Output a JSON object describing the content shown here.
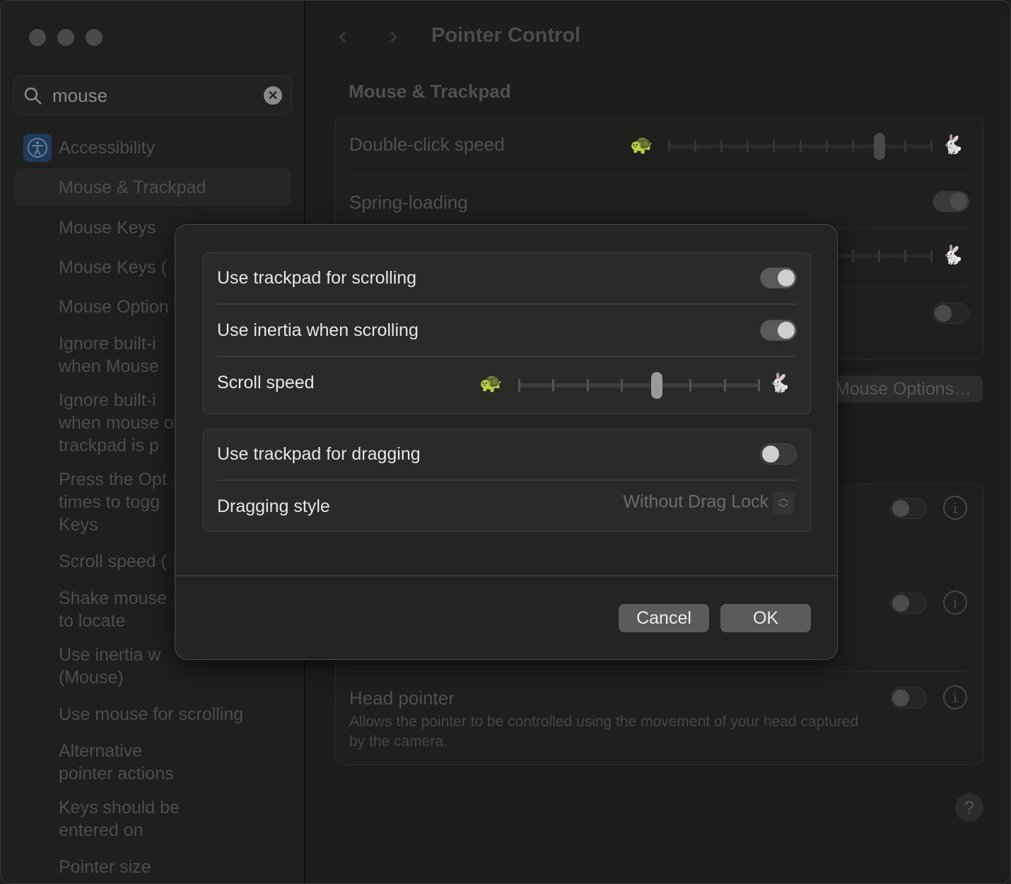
{
  "window": {
    "title": "Pointer Control",
    "traffic_lights": [
      "close",
      "minimize",
      "zoom"
    ]
  },
  "sidebar": {
    "search": {
      "value": "mouse",
      "placeholder": "Search"
    },
    "category": "Accessibility",
    "selected": "Mouse & Trackpad",
    "items": [
      {
        "label": "Mouse & Trackpad"
      },
      {
        "label": "Mouse Keys"
      },
      {
        "label": "Mouse Keys ("
      },
      {
        "label": "Mouse Option"
      },
      {
        "label": "Ignore built-i\nwhen Mouse"
      },
      {
        "label": "Ignore built-i\nwhen mouse o\ntrackpad is p"
      },
      {
        "label": "Press the Opt\ntimes to togg\nKeys"
      },
      {
        "label": "Scroll speed ("
      },
      {
        "label": "Shake mouse\nto locate"
      },
      {
        "label": "Use inertia w\n(Mouse)"
      },
      {
        "label": "Use mouse for scrolling"
      },
      {
        "label": "Alternative\npointer actions"
      },
      {
        "label": "Keys should be\nentered on"
      },
      {
        "label": "Pointer size"
      }
    ]
  },
  "main": {
    "section": "Mouse & Trackpad",
    "group1": {
      "double_click": {
        "label": "Double-click speed",
        "ticks": 11,
        "value_index": 8
      },
      "spring_loading": {
        "label": "Spring-loading",
        "on": true
      },
      "row3_slider": {
        "ticks": 11
      },
      "row4_toggle": {
        "on": false
      }
    },
    "options_button": "Mouse Options…",
    "group2": {
      "row1": {
        "on": false
      },
      "row2": {
        "on": false
      },
      "head_pointer": {
        "label": "Head pointer",
        "description": "Allows the pointer to be controlled using the movement of your head captured by the camera.",
        "on": false
      }
    },
    "help": "?"
  },
  "dialog": {
    "scrolling": {
      "label": "Use trackpad for scrolling",
      "on": true
    },
    "inertia": {
      "label": "Use inertia when scrolling",
      "on": true
    },
    "scroll_speed": {
      "label": "Scroll speed",
      "ticks": 8,
      "value_index": 4
    },
    "dragging": {
      "label": "Use trackpad for dragging",
      "on": false
    },
    "dragging_style": {
      "label": "Dragging style",
      "value": "Without Drag Lock"
    },
    "cancel": "Cancel",
    "ok": "OK"
  }
}
